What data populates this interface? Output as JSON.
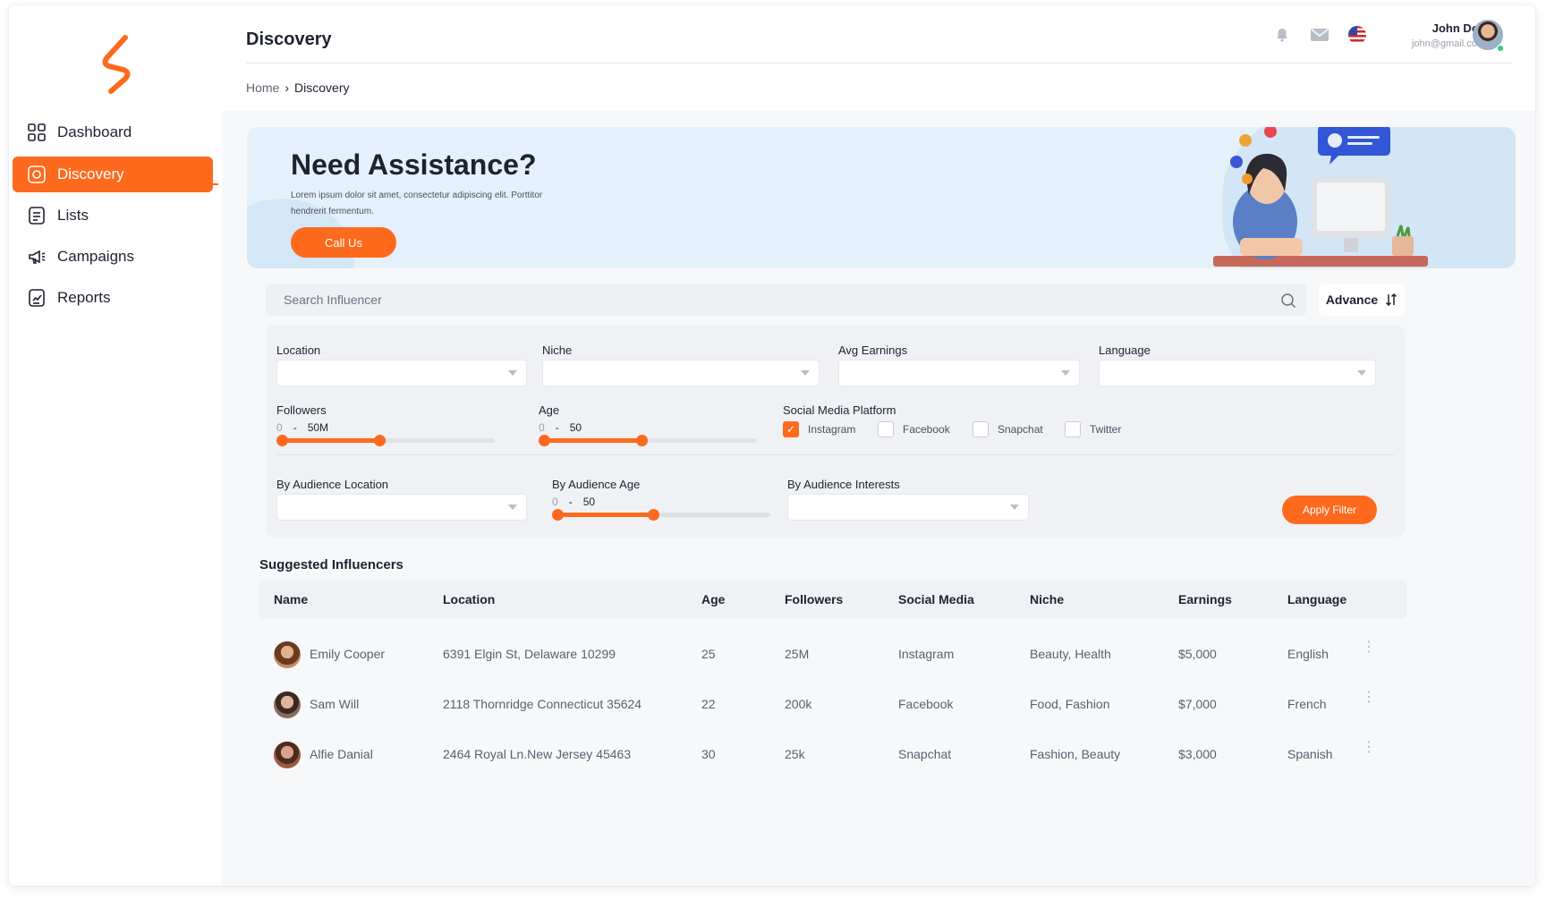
{
  "sidebar": {
    "items": [
      {
        "label": "Dashboard",
        "icon": "grid-icon",
        "active": false
      },
      {
        "label": "Discovery",
        "icon": "compass-icon",
        "active": true
      },
      {
        "label": "Lists",
        "icon": "list-icon",
        "active": false
      },
      {
        "label": "Campaigns",
        "icon": "megaphone-icon",
        "active": false
      },
      {
        "label": "Reports",
        "icon": "report-icon",
        "active": false
      }
    ]
  },
  "header": {
    "title": "Discovery",
    "user_name": "John Doe",
    "user_email": "john@gmail.com"
  },
  "breadcrumb": {
    "home": "Home",
    "separator": "›",
    "current": "Discovery"
  },
  "hero": {
    "title": "Need Assistance?",
    "text": "Lorem ipsum dolor sit amet, consectetur adipiscing elit. Porttitor hendrerit fermentum.",
    "button": "Call Us"
  },
  "search": {
    "placeholder": "Search Influencer",
    "advance_label": "Advance"
  },
  "filters": {
    "location_label": "Location",
    "niche_label": "Niche",
    "earnings_label": "Avg Earnings",
    "language_label": "Language",
    "followers": {
      "label": "Followers",
      "min": "0",
      "sep": "-",
      "max": "50M",
      "selected_fraction": 0.46
    },
    "age": {
      "label": "Age",
      "min": "0",
      "sep": "-",
      "max": "50",
      "selected_fraction": 0.46
    },
    "platform_label": "Social Media Platform",
    "platforms": [
      {
        "label": "Instagram",
        "checked": true
      },
      {
        "label": "Facebook",
        "checked": false
      },
      {
        "label": "Snapchat",
        "checked": false
      },
      {
        "label": "Twitter",
        "checked": false
      }
    ],
    "aud_location_label": "By Audience Location",
    "aud_age": {
      "label": "By Audience Age",
      "min": "0",
      "sep": "-",
      "max": "50",
      "selected_fraction": 0.45
    },
    "aud_interests_label": "By Audience Interests",
    "apply": "Apply Filter"
  },
  "table": {
    "title": "Suggested Influencers",
    "columns": [
      "Name",
      "Location",
      "Age",
      "Followers",
      "Social Media",
      "Niche",
      "Earnings",
      "Language"
    ],
    "rows": [
      {
        "name": "Emily Cooper",
        "location": "6391 Elgin St, Delaware 10299",
        "age": "25",
        "followers": "25M",
        "social": "Instagram",
        "niche": "Beauty, Health",
        "earnings": "$5,000",
        "language": "English"
      },
      {
        "name": "Sam Will",
        "location": "2118 Thornridge Connecticut 35624",
        "age": "22",
        "followers": "200k",
        "social": "Facebook",
        "niche": "Food, Fashion",
        "earnings": "$7,000",
        "language": "French"
      },
      {
        "name": "Alfie Danial",
        "location": "2464 Royal Ln.New Jersey 45463",
        "age": "30",
        "followers": "25k",
        "social": "Snapchat",
        "niche": "Fashion, Beauty",
        "earnings": "$3,000",
        "language": "Spanish"
      }
    ]
  },
  "colors": {
    "accent": "#fd6a1e",
    "panel": "#f0f1f4",
    "hero": "#e4f1fb"
  }
}
